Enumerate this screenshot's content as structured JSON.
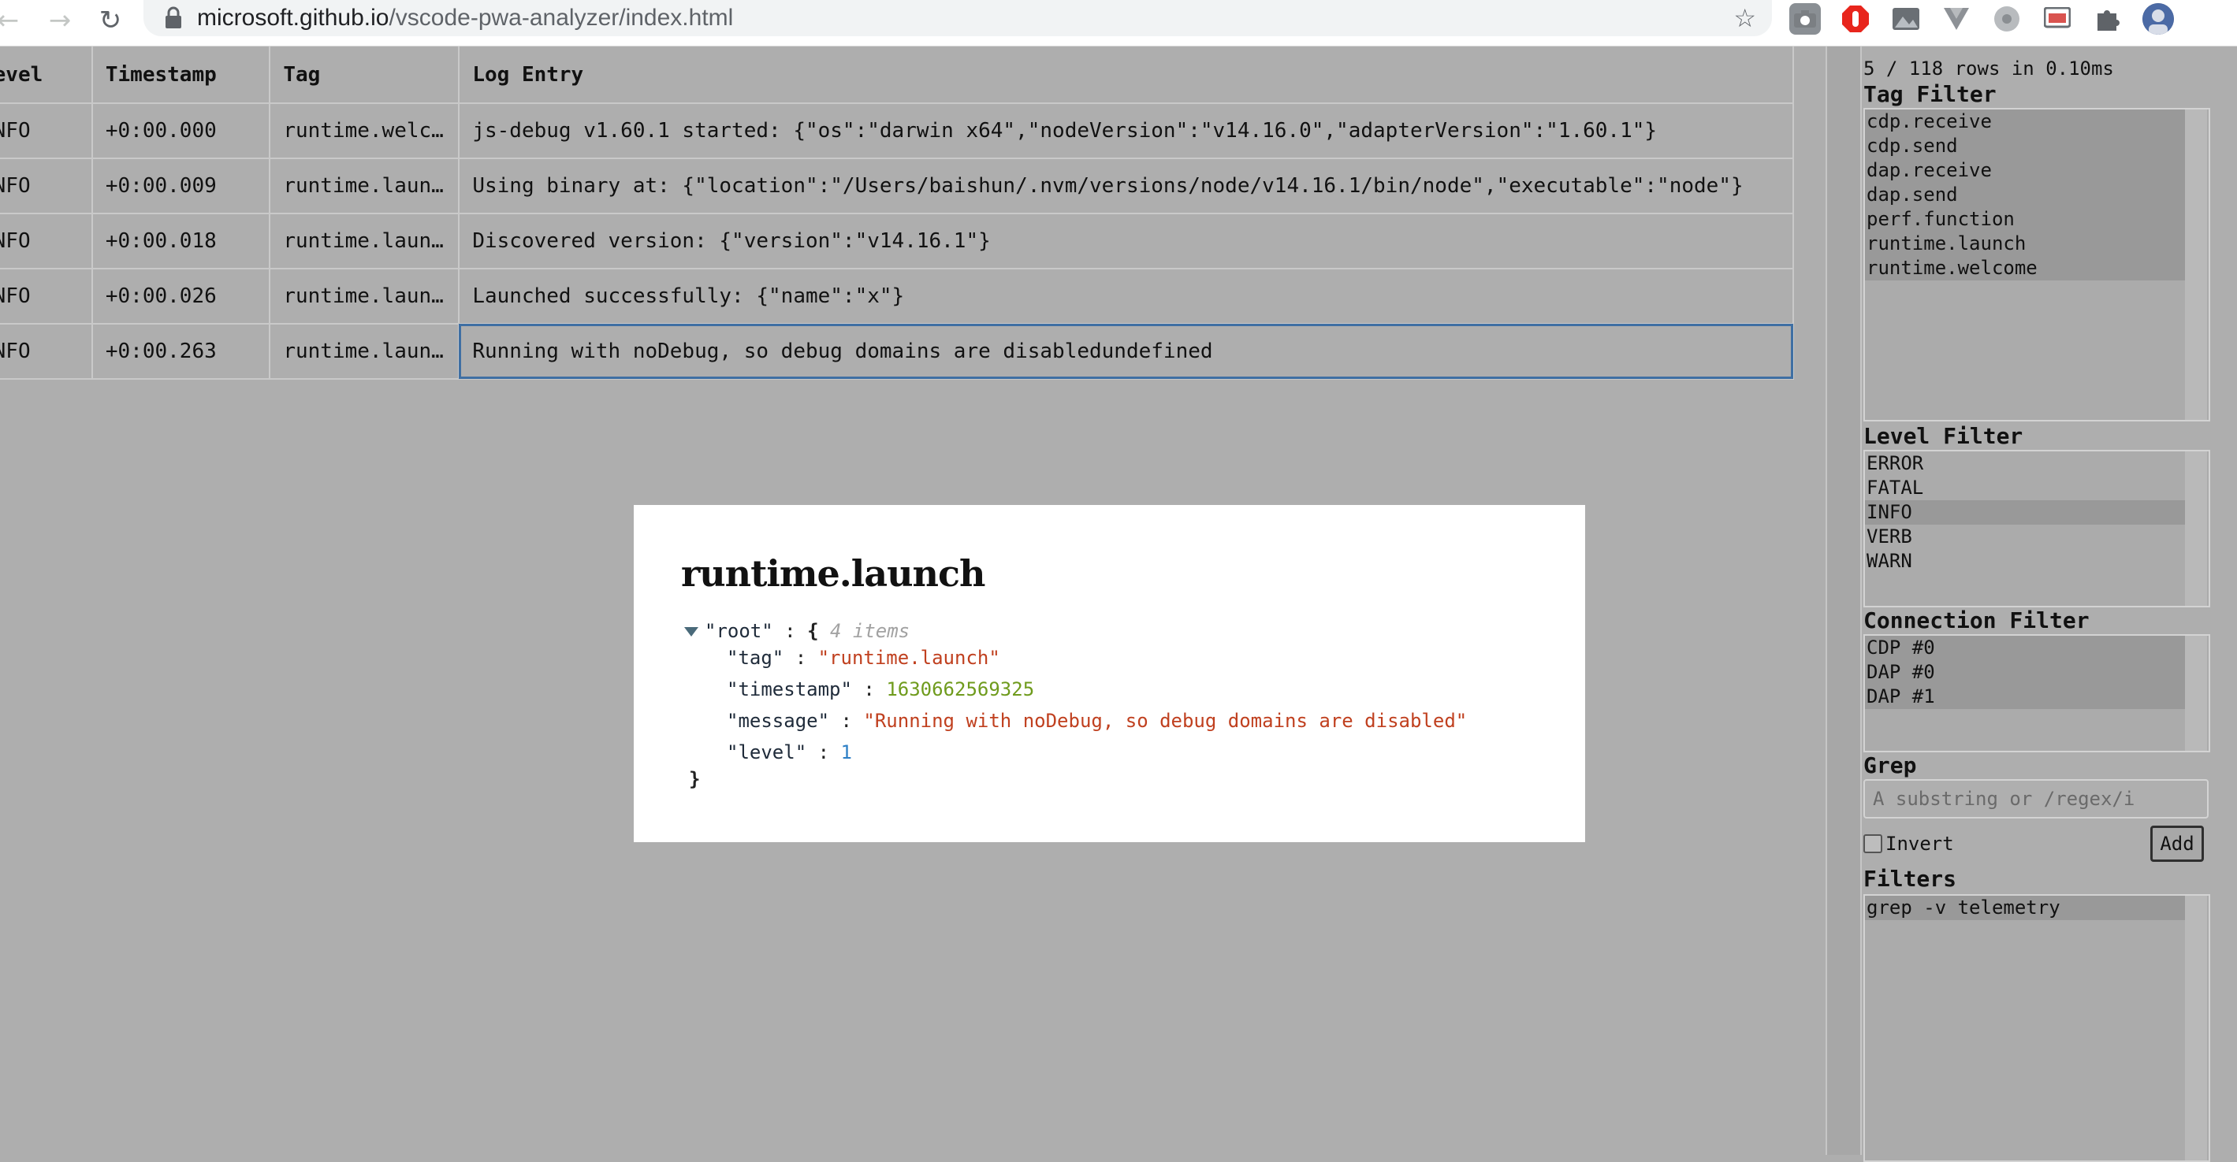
{
  "browser": {
    "url_host": "microsoft.github.io",
    "url_path": "/vscode-pwa-analyzer/index.html",
    "back_icon": "←",
    "forward_icon": "→",
    "reload_icon": "↻",
    "star_icon": "☆"
  },
  "table": {
    "headers": [
      "Level",
      "Timestamp",
      "Tag",
      "Log Entry"
    ],
    "rows": [
      {
        "level": "INFO",
        "timestamp": "+0:00.000",
        "tag": "runtime.welcome",
        "message": "js-debug v1.60.1 started: {\"os\":\"darwin x64\",\"nodeVersion\":\"v14.16.0\",\"adapterVersion\":\"1.60.1\"}"
      },
      {
        "level": "INFO",
        "timestamp": "+0:00.009",
        "tag": "runtime.launch",
        "message": "Using binary at: {\"location\":\"/Users/baishun/.nvm/versions/node/v14.16.1/bin/node\",\"executable\":\"node\"}"
      },
      {
        "level": "INFO",
        "timestamp": "+0:00.018",
        "tag": "runtime.launch",
        "message": "Discovered version: {\"version\":\"v14.16.1\"}"
      },
      {
        "level": "INFO",
        "timestamp": "+0:00.026",
        "tag": "runtime.launch",
        "message": "Launched successfully: {\"name\":\"x\"}"
      },
      {
        "level": "INFO",
        "timestamp": "+0:00.263",
        "tag": "runtime.launch",
        "message": "Running with noDebug, so debug domains are disabledundefined"
      }
    ]
  },
  "sidebar": {
    "summary": "5 / 118 rows in 0.10ms",
    "tag_filter": {
      "title": "Tag Filter",
      "options": [
        "cdp.receive",
        "cdp.send",
        "dap.receive",
        "dap.send",
        "perf.function",
        "runtime.launch",
        "runtime.welcome"
      ]
    },
    "level_filter": {
      "title": "Level Filter",
      "options": [
        "ERROR",
        "FATAL",
        "INFO",
        "VERB",
        "WARN"
      ],
      "selected": "INFO"
    },
    "connection_filter": {
      "title": "Connection Filter",
      "options": [
        "CDP #0",
        "DAP #0",
        "DAP #1"
      ]
    },
    "grep": {
      "title": "Grep",
      "placeholder": "A substring or /regex/i",
      "invert_label": "Invert",
      "add_label": "Add"
    },
    "filters": {
      "title": "Filters",
      "options": [
        "grep -v telemetry"
      ]
    }
  },
  "modal": {
    "title": "runtime.launch",
    "root_label": "\"root\"",
    "item_count": "4 items",
    "fields": [
      {
        "key": "\"tag\"",
        "value": "\"runtime.launch\""
      },
      {
        "key": "\"timestamp\"",
        "value": "1630662569325"
      },
      {
        "key": "\"message\"",
        "value": "\"Running with noDebug, so debug domains are disabled\""
      },
      {
        "key": "\"level\"",
        "value": "1"
      }
    ]
  },
  "colors": {
    "background": "#aeaeae",
    "selected_outline": "#3f6fa3",
    "json_string": "#c0401f",
    "json_number_long": "#6f9b1d",
    "json_number_small": "#2d7fc6"
  }
}
